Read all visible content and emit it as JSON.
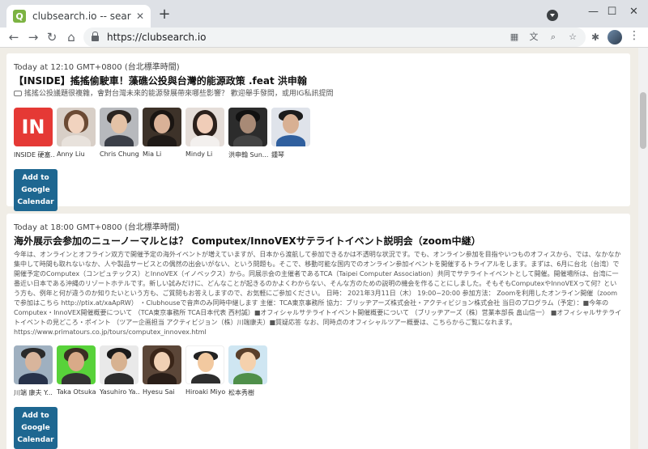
{
  "browser": {
    "tab_title": "clubsearch.io -- search Clubho",
    "tab_close": "✕",
    "new_tab": "+",
    "url": "https://clubsearch.io",
    "window_controls": {
      "minimize": "—",
      "maximize": "☐",
      "close": "✕"
    }
  },
  "events": [
    {
      "time": "Today at 12:10 GMT+0800 (台北標準時間)",
      "title": "【INSIDE】搖搖偷駛車！藻礁公投與台灣的能源政策 .feat 洪申翰",
      "description": "搖搖公投議題很複雜，會對台灣未來的能源發展帶來哪些影響？ 歡迎舉手發問，或用IG私訊提問",
      "people": [
        {
          "name": "INSIDE 硬塞...",
          "avatar": "logo-in",
          "logo_text": "IN"
        },
        {
          "name": "Anny Liu",
          "avatar": "woman-light"
        },
        {
          "name": "Chris Chung",
          "avatar": "man-glasses"
        },
        {
          "name": "Mia Li",
          "avatar": "woman-dark"
        },
        {
          "name": "Mindy Li",
          "avatar": "woman-long"
        },
        {
          "name": "洪申翰 Sun...",
          "avatar": "man-dark"
        },
        {
          "name": "鍾琴",
          "avatar": "man-blue"
        }
      ],
      "calendar_button": "Add to Google Calendar"
    },
    {
      "time": "Today at 18:00 GMT+0800 (台北標準時間)",
      "title": "海外展示会参加のニューノーマルとは？ Computex/InnoVEXサテライトイベント説明会（zoom中継）",
      "description": "今年は、オンラインとオフライン双方で開催予定の海外イベントが増えていますが、日本から渡航して参加できるかは不透明な状況です。でも、オンライン参加を目指やいつものオフィスから、では、なかなか集中して時間も取れないなか、人や製品サービスとの偶然の出会いがない、という問題も。そこで、移動可能な国内でのオンライン参加イベントを開催するトライアルをします。まずは、6月に台北（台湾）で開催予定のComputex（コンピュテックス）とInnoVEX（イノベックス）から。同展示会の主催者であるTCA（Taipei Computer Association）共同でサテライトイベントとして開催。開催場所は、台湾に一番近い日本である沖縄のリゾートホテルです。新しい試みだけに、どんなことが起きるのかよくわからない、そんな方のための説明の機会を作ることにしました。そもそもComputexやInnoVEXって何？という方も、例年と何が違うのか知りたいという方も、ご質問もお答えしますので、お気軽にご参加ください。 日時： 2021年3月11日（木） 19:00~20:00 参加方法： Zoomを利用したオンライン開催（zoomで参加はこちら http://ptix.at/xaApRW） ・Clubhouseで音声のみ同時中継します 主催：TCA東京事務所 協力：ブリッヂアーズ株式会社・アクティビジョン株式会社 当日のプログラム（予定）：■今年のComputex・InnoVEX開催概要について （TCA東京事務所 TCA日本代表 西村誠）■オフィシャルサテライトイベント開催概要について （ブリッヂアーズ（株）営業本部長 畠山信一） ■オフィシャルサテライトイベントの見どころ・ポイント （ツアー企画担当 アクティビジョン（株）川端康夫）■質疑応答 なお、同時点のオフィシャルツアー概要は、こちらからご覧になれます。 https://www.primatours.co.jp/tours/computex_innovex.html",
      "people": [
        {
          "name": "川端 康夫 Y...",
          "avatar": "man-suit"
        },
        {
          "name": "Taka Otsuka",
          "avatar": "man-green"
        },
        {
          "name": "Yasuhiro Ya...",
          "avatar": "man-short"
        },
        {
          "name": "Hyesu Sai",
          "avatar": "woman-round"
        },
        {
          "name": "Hiroaki Miyo...",
          "avatar": "cartoon-man"
        },
        {
          "name": "松本秀樹",
          "avatar": "cartoon-glasses"
        }
      ],
      "calendar_button": "Add to Google Calendar"
    }
  ]
}
